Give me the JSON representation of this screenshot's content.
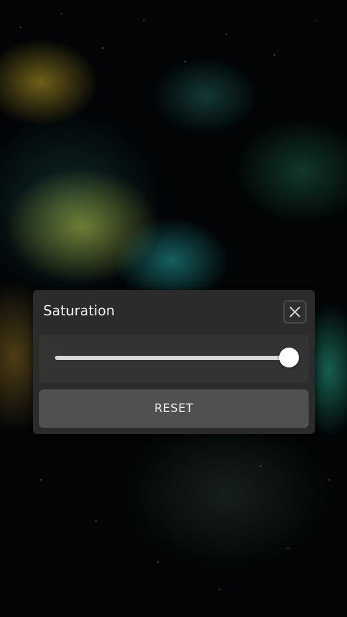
{
  "dialog": {
    "title": "Saturation",
    "close_icon": "close-icon",
    "slider": {
      "value": 1.0
    },
    "reset_label": "RESET"
  }
}
